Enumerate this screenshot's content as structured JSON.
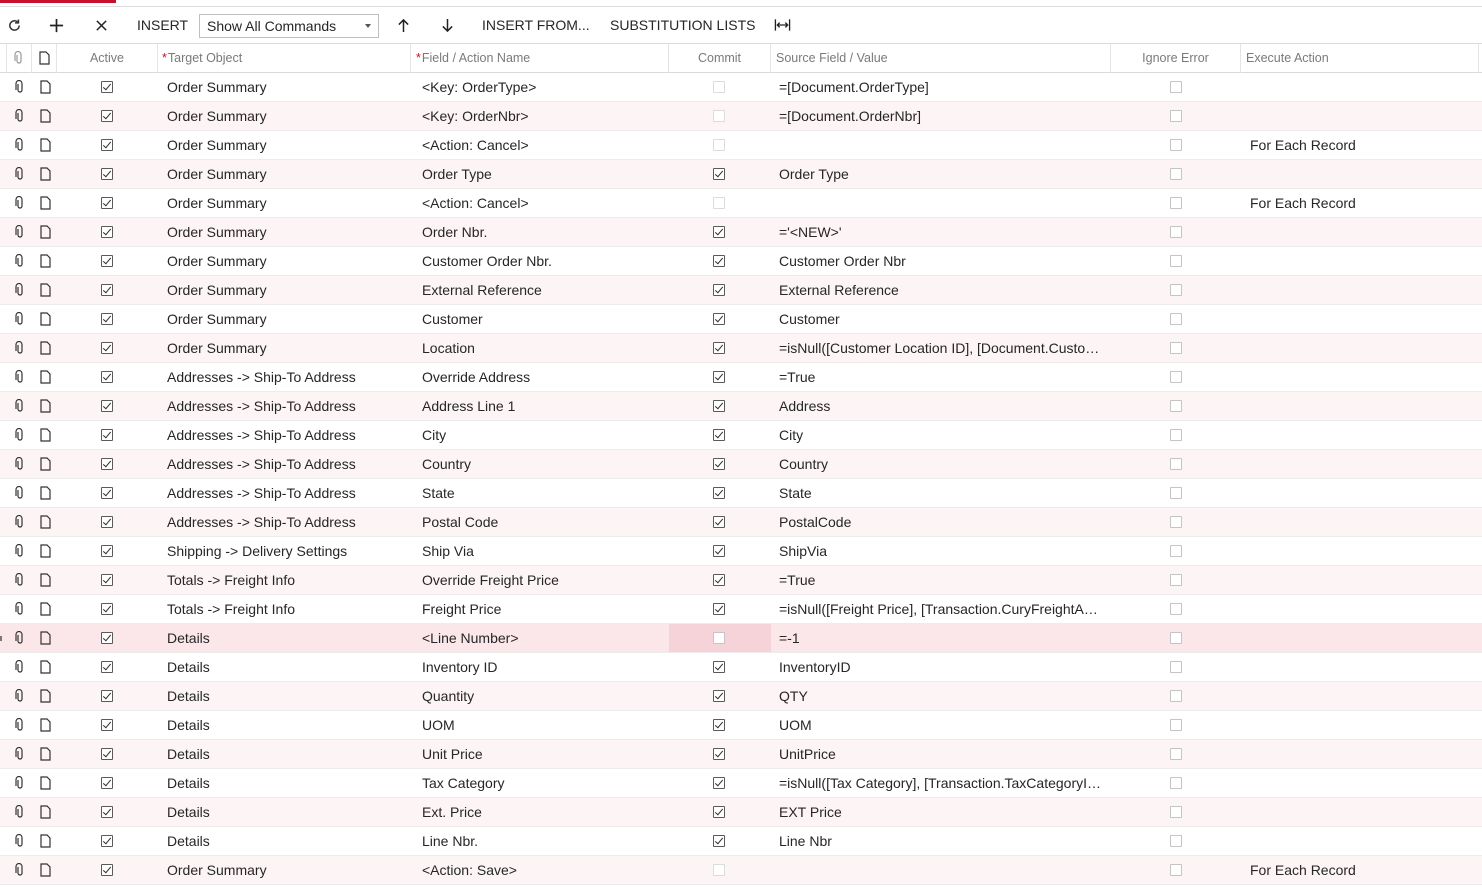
{
  "toolbar": {
    "refresh_icon": "refresh-icon",
    "add_icon": "plus-icon",
    "delete_icon": "close-icon",
    "insert_label": "INSERT",
    "command_filter": "Show All Commands",
    "move_up_icon": "arrow-up-icon",
    "move_down_icon": "arrow-down-icon",
    "insert_from_label": "INSERT FROM...",
    "substitution_lists_label": "SUBSTITUTION LISTS",
    "fit_columns_icon": "fit-columns-icon"
  },
  "grid": {
    "columns": {
      "active": "Active",
      "target_object": "Target Object",
      "field_action": "Field / Action Name",
      "commit": "Commit",
      "source_value": "Source Field / Value",
      "ignore_error": "Ignore Error",
      "execute_action": "Execute Action"
    },
    "required_mark": "*",
    "selected_row_index": 19,
    "rows": [
      {
        "active": true,
        "target": "Order Summary",
        "field": "<Key: OrderType>",
        "commit": false,
        "commit_disabled": true,
        "source": "=[Document.OrderType]",
        "ignore_error": false,
        "execute": ""
      },
      {
        "active": true,
        "target": "Order Summary",
        "field": "<Key: OrderNbr>",
        "commit": false,
        "commit_disabled": true,
        "source": "=[Document.OrderNbr]",
        "ignore_error": false,
        "execute": ""
      },
      {
        "active": true,
        "target": "Order Summary",
        "field": "<Action: Cancel>",
        "commit": false,
        "commit_disabled": true,
        "source": "",
        "ignore_error": false,
        "execute": "For Each Record"
      },
      {
        "active": true,
        "target": "Order Summary",
        "field": "Order Type",
        "commit": true,
        "commit_disabled": false,
        "source": "Order Type",
        "ignore_error": false,
        "execute": ""
      },
      {
        "active": true,
        "target": "Order Summary",
        "field": "<Action: Cancel>",
        "commit": false,
        "commit_disabled": true,
        "source": "",
        "ignore_error": false,
        "execute": "For Each Record"
      },
      {
        "active": true,
        "target": "Order Summary",
        "field": "Order Nbr.",
        "commit": true,
        "commit_disabled": false,
        "source": "='<NEW>'",
        "ignore_error": false,
        "execute": ""
      },
      {
        "active": true,
        "target": "Order Summary",
        "field": "Customer Order Nbr.",
        "commit": true,
        "commit_disabled": false,
        "source": "Customer Order Nbr",
        "ignore_error": false,
        "execute": ""
      },
      {
        "active": true,
        "target": "Order Summary",
        "field": "External Reference",
        "commit": true,
        "commit_disabled": false,
        "source": "External Reference",
        "ignore_error": false,
        "execute": ""
      },
      {
        "active": true,
        "target": "Order Summary",
        "field": "Customer",
        "commit": true,
        "commit_disabled": false,
        "source": "Customer",
        "ignore_error": false,
        "execute": ""
      },
      {
        "active": true,
        "target": "Order Summary",
        "field": "Location",
        "commit": true,
        "commit_disabled": false,
        "source": "=isNull([Customer Location ID], [Document.Customer...",
        "ignore_error": false,
        "execute": ""
      },
      {
        "active": true,
        "target": "Addresses -> Ship-To Address",
        "field": "Override Address",
        "commit": true,
        "commit_disabled": false,
        "source": "=True",
        "ignore_error": false,
        "execute": ""
      },
      {
        "active": true,
        "target": "Addresses -> Ship-To Address",
        "field": "Address Line 1",
        "commit": true,
        "commit_disabled": false,
        "source": "Address",
        "ignore_error": false,
        "execute": ""
      },
      {
        "active": true,
        "target": "Addresses -> Ship-To Address",
        "field": "City",
        "commit": true,
        "commit_disabled": false,
        "source": "City",
        "ignore_error": false,
        "execute": ""
      },
      {
        "active": true,
        "target": "Addresses -> Ship-To Address",
        "field": "Country",
        "commit": true,
        "commit_disabled": false,
        "source": "Country",
        "ignore_error": false,
        "execute": ""
      },
      {
        "active": true,
        "target": "Addresses -> Ship-To Address",
        "field": "State",
        "commit": true,
        "commit_disabled": false,
        "source": "State",
        "ignore_error": false,
        "execute": ""
      },
      {
        "active": true,
        "target": "Addresses -> Ship-To Address",
        "field": "Postal Code",
        "commit": true,
        "commit_disabled": false,
        "source": "PostalCode",
        "ignore_error": false,
        "execute": ""
      },
      {
        "active": true,
        "target": "Shipping -> Delivery Settings",
        "field": "Ship Via",
        "commit": true,
        "commit_disabled": false,
        "source": "ShipVia",
        "ignore_error": false,
        "execute": ""
      },
      {
        "active": true,
        "target": "Totals -> Freight Info",
        "field": "Override Freight Price",
        "commit": true,
        "commit_disabled": false,
        "source": "=True",
        "ignore_error": false,
        "execute": ""
      },
      {
        "active": true,
        "target": "Totals -> Freight Info",
        "field": "Freight Price",
        "commit": true,
        "commit_disabled": false,
        "source": "=isNull([Freight Price], [Transaction.CuryFreightAmt])",
        "ignore_error": false,
        "execute": ""
      },
      {
        "active": true,
        "target": "Details",
        "field": "<Line Number>",
        "commit": false,
        "commit_disabled": false,
        "source": "=-1",
        "ignore_error": false,
        "execute": ""
      },
      {
        "active": true,
        "target": "Details",
        "field": "Inventory ID",
        "commit": true,
        "commit_disabled": false,
        "source": "InventoryID",
        "ignore_error": false,
        "execute": ""
      },
      {
        "active": true,
        "target": "Details",
        "field": "Quantity",
        "commit": true,
        "commit_disabled": false,
        "source": "QTY",
        "ignore_error": false,
        "execute": ""
      },
      {
        "active": true,
        "target": "Details",
        "field": "UOM",
        "commit": true,
        "commit_disabled": false,
        "source": "UOM",
        "ignore_error": false,
        "execute": ""
      },
      {
        "active": true,
        "target": "Details",
        "field": "Unit Price",
        "commit": true,
        "commit_disabled": false,
        "source": "UnitPrice",
        "ignore_error": false,
        "execute": ""
      },
      {
        "active": true,
        "target": "Details",
        "field": "Tax Category",
        "commit": true,
        "commit_disabled": false,
        "source": "=isNull([Tax Category], [Transaction.TaxCategoryID])",
        "ignore_error": false,
        "execute": ""
      },
      {
        "active": true,
        "target": "Details",
        "field": "Ext. Price",
        "commit": true,
        "commit_disabled": false,
        "source": "EXT Price",
        "ignore_error": false,
        "execute": ""
      },
      {
        "active": true,
        "target": "Details",
        "field": "Line Nbr.",
        "commit": true,
        "commit_disabled": false,
        "source": "Line Nbr",
        "ignore_error": false,
        "execute": ""
      },
      {
        "active": true,
        "target": "Order Summary",
        "field": "<Action: Save>",
        "commit": false,
        "commit_disabled": true,
        "source": "",
        "ignore_error": false,
        "execute": "For Each Record"
      }
    ]
  }
}
